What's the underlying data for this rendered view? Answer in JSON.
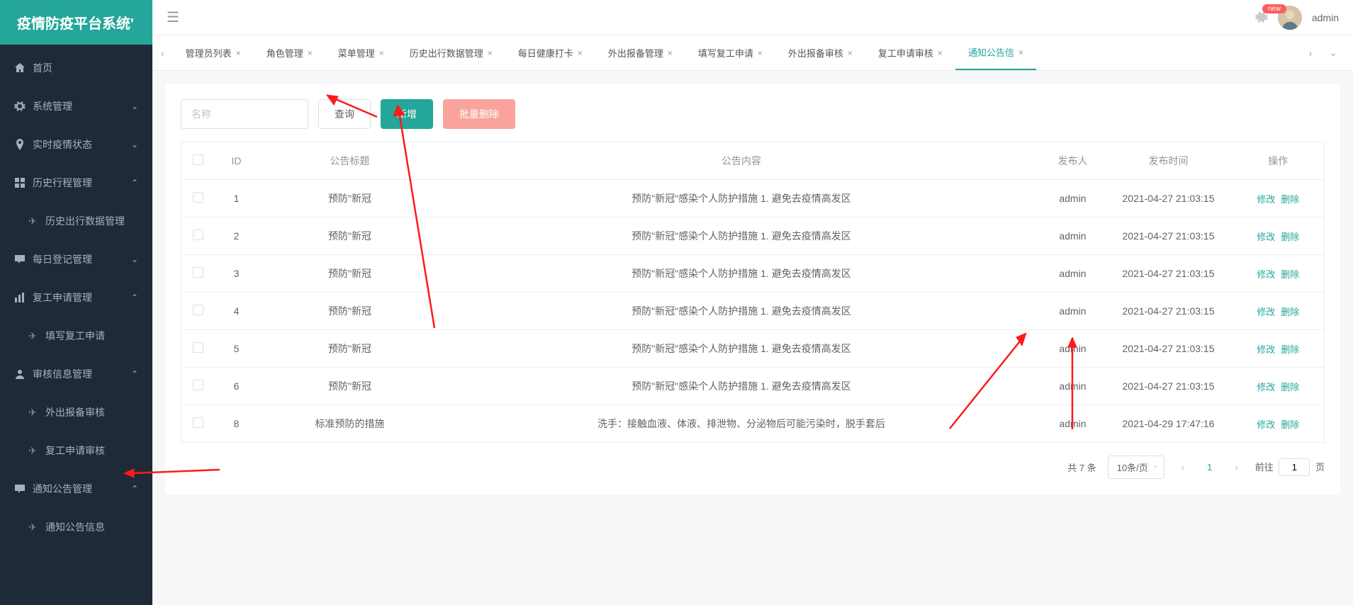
{
  "app": {
    "title": "疫情防疫平台系统'"
  },
  "header": {
    "badge": "new",
    "username": "admin"
  },
  "sidebar": {
    "items": [
      {
        "label": "首页",
        "type": "item",
        "icon": "home"
      },
      {
        "label": "系统管理",
        "type": "submenu",
        "icon": "gear",
        "arrow": "down"
      },
      {
        "label": "实时疫情状态",
        "type": "submenu",
        "icon": "marker",
        "arrow": "down"
      },
      {
        "label": "历史行程管理",
        "type": "submenu",
        "icon": "grid",
        "arrow": "up",
        "children": [
          {
            "label": "历史出行数据管理"
          }
        ]
      },
      {
        "label": "每日登记管理",
        "type": "submenu",
        "icon": "chat",
        "arrow": "down"
      },
      {
        "label": "复工申请管理",
        "type": "submenu",
        "icon": "bars",
        "arrow": "up",
        "children": [
          {
            "label": "填写复工申请"
          }
        ]
      },
      {
        "label": "审核信息管理",
        "type": "submenu",
        "icon": "user",
        "arrow": "up",
        "children": [
          {
            "label": "外出报备审核"
          },
          {
            "label": "复工申请审核"
          }
        ]
      },
      {
        "label": "通知公告管理",
        "type": "submenu",
        "icon": "chat",
        "arrow": "up",
        "children": [
          {
            "label": "通知公告信息"
          }
        ]
      }
    ]
  },
  "tabs": [
    {
      "label": "管理员列表"
    },
    {
      "label": "角色管理"
    },
    {
      "label": "菜单管理"
    },
    {
      "label": "历史出行数据管理"
    },
    {
      "label": "每日健康打卡"
    },
    {
      "label": "外出报备管理"
    },
    {
      "label": "填写复工申请"
    },
    {
      "label": "外出报备审核"
    },
    {
      "label": "复工申请审核"
    },
    {
      "label": "通知公告信",
      "active": true
    }
  ],
  "controls": {
    "search_placeholder": "名称",
    "query_label": "查询",
    "add_label": "新增",
    "batch_delete_label": "批量删除"
  },
  "table": {
    "headers": {
      "id": "ID",
      "title": "公告标题",
      "content": "公告内容",
      "publisher": "发布人",
      "time": "发布时间",
      "action": "操作"
    },
    "action_labels": {
      "edit": "修改",
      "delete": "删除"
    },
    "rows": [
      {
        "id": "1",
        "title": "预防\"新冠",
        "content": "预防\"新冠\"感染个人防护措施 1. 避免去疫情高发区",
        "publisher": "admin",
        "time": "2021-04-27 21:03:15"
      },
      {
        "id": "2",
        "title": "预防\"新冠",
        "content": "预防\"新冠\"感染个人防护措施 1. 避免去疫情高发区",
        "publisher": "admin",
        "time": "2021-04-27 21:03:15"
      },
      {
        "id": "3",
        "title": "预防\"新冠",
        "content": "预防\"新冠\"感染个人防护措施 1. 避免去疫情高发区",
        "publisher": "admin",
        "time": "2021-04-27 21:03:15"
      },
      {
        "id": "4",
        "title": "预防\"新冠",
        "content": "预防\"新冠\"感染个人防护措施 1. 避免去疫情高发区",
        "publisher": "admin",
        "time": "2021-04-27 21:03:15"
      },
      {
        "id": "5",
        "title": "预防\"新冠",
        "content": "预防\"新冠\"感染个人防护措施 1. 避免去疫情高发区",
        "publisher": "admin",
        "time": "2021-04-27 21:03:15"
      },
      {
        "id": "6",
        "title": "预防\"新冠",
        "content": "预防\"新冠\"感染个人防护措施 1. 避免去疫情高发区",
        "publisher": "admin",
        "time": "2021-04-27 21:03:15"
      },
      {
        "id": "8",
        "title": "标准预防的措施",
        "content": "洗手：接触血液、体液、排泄物、分泌物后可能污染时，脱手套后",
        "publisher": "admin",
        "time": "2021-04-29 17:47:16"
      }
    ]
  },
  "pagination": {
    "total_text": "共 7 条",
    "page_size_label": "10条/页",
    "current_page": "1",
    "goto_prefix": "前往",
    "goto_input": "1",
    "goto_suffix": "页"
  }
}
